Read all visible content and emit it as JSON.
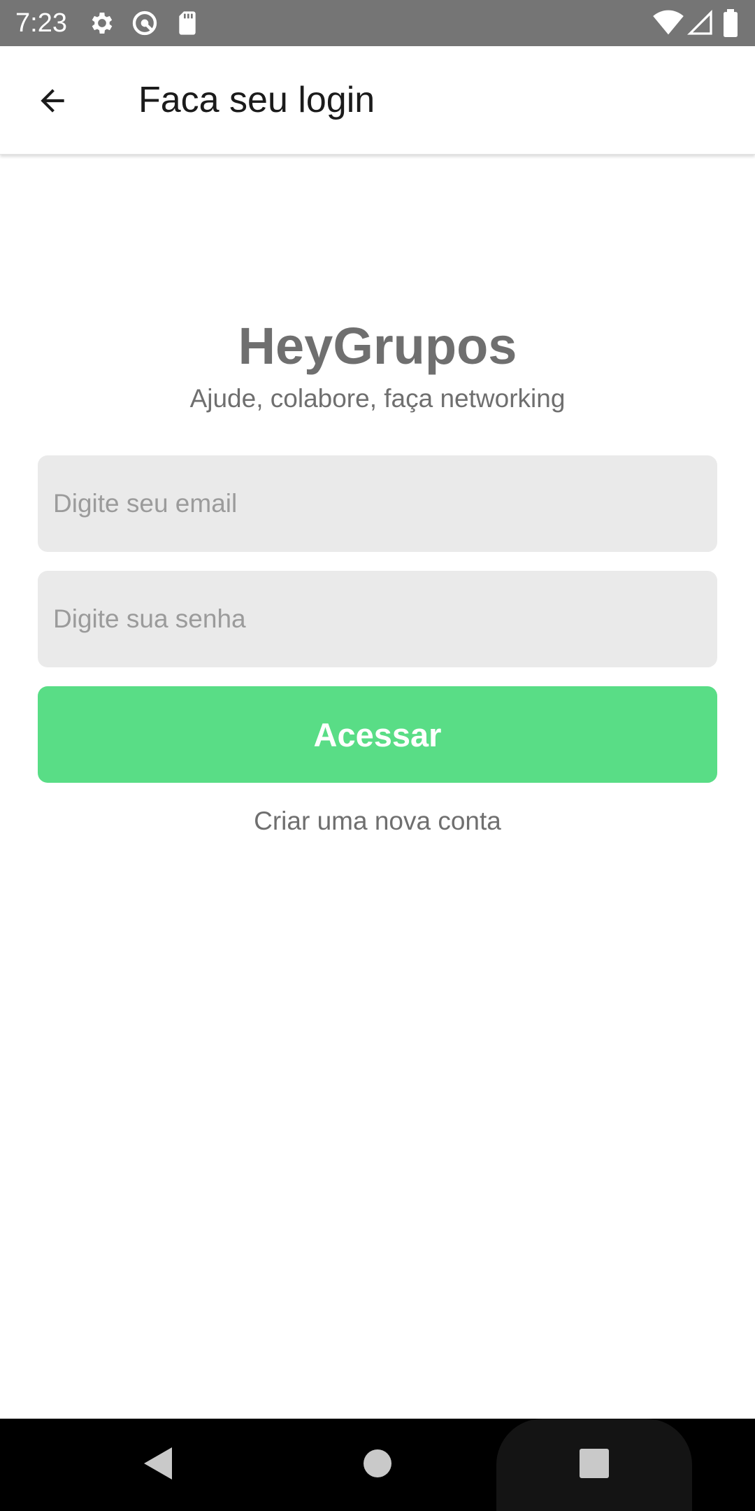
{
  "status_bar": {
    "time": "7:23",
    "icons": [
      "settings-gear-icon",
      "do-not-disturb-icon",
      "sd-card-icon",
      "wifi-icon",
      "cell-signal-icon",
      "battery-icon"
    ]
  },
  "app_bar": {
    "back_icon": "arrow-back-icon",
    "title": "Faca seu login"
  },
  "brand": {
    "title": "HeyGrupos",
    "subtitle": "Ajude, colabore, faça networking"
  },
  "form": {
    "email": {
      "value": "",
      "placeholder": "Digite seu email"
    },
    "password": {
      "value": "",
      "placeholder": "Digite sua senha"
    },
    "submit_label": "Acessar",
    "create_account_label": "Criar uma nova conta"
  },
  "nav_bar": {
    "buttons": [
      "back-triangle-icon",
      "home-circle-icon",
      "recents-square-icon"
    ]
  },
  "colors": {
    "accent": "#59dd86",
    "field_bg": "#eaeaea",
    "muted_text": "#6f6f6f",
    "status_bar": "#757575"
  }
}
